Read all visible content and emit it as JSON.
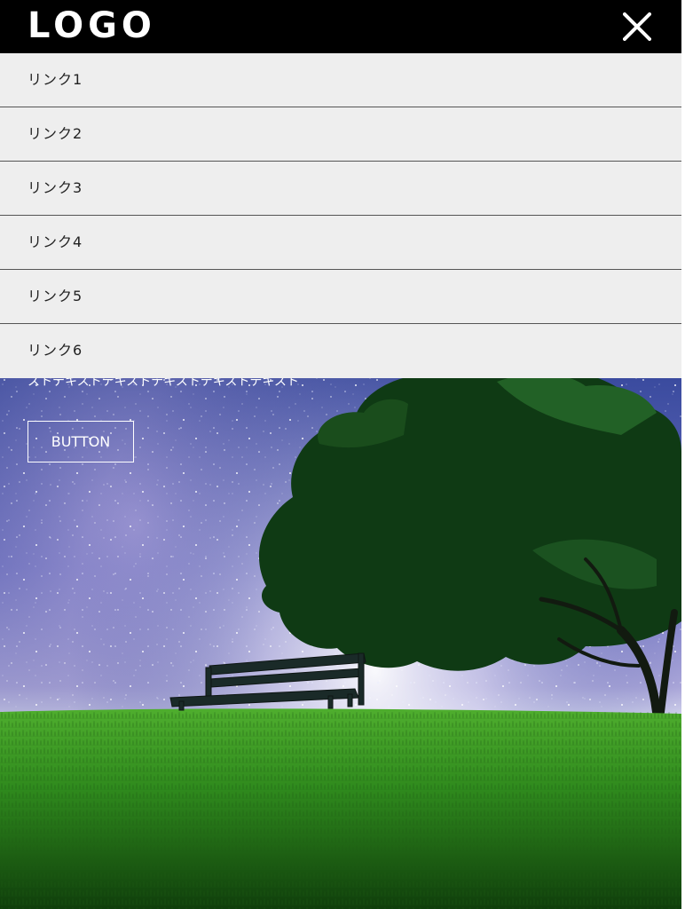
{
  "header": {
    "logo_text": "LOGO",
    "close_icon": "close-icon",
    "background": "#000000",
    "foreground": "#ffffff"
  },
  "nav": {
    "items": [
      {
        "label": "リンク1"
      },
      {
        "label": "リンク2"
      },
      {
        "label": "リンク3"
      },
      {
        "label": "リンク4"
      },
      {
        "label": "リンク5"
      },
      {
        "label": "リンク6"
      }
    ],
    "background": "#eeeeee",
    "divider": "#555555"
  },
  "hero": {
    "text": "ストテキストテキストテキストテキストテキスト",
    "button_label": "BUTTON",
    "scene": "starry-night-bench-tree-on-grass"
  }
}
